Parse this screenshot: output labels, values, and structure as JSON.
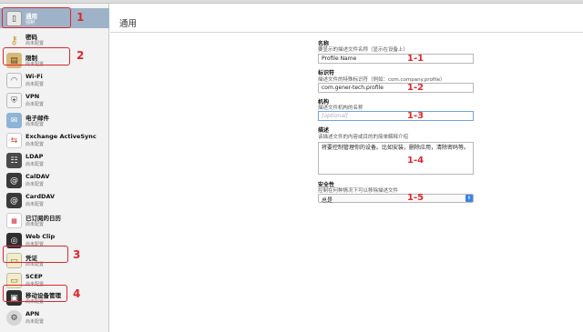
{
  "page": {
    "title": "通用"
  },
  "sidebar": {
    "items": [
      {
        "name": "通用",
        "sub": "强制",
        "icon": "general-profile-icon",
        "selected": true
      },
      {
        "name": "密码",
        "sub": "尚未配置",
        "icon": "key-icon"
      },
      {
        "name": "限制",
        "sub": "尚未配置",
        "icon": "restrictions-icon"
      },
      {
        "name": "Wi-Fi",
        "sub": "尚未配置",
        "icon": "wifi-icon"
      },
      {
        "name": "VPN",
        "sub": "尚未配置",
        "icon": "vpn-icon"
      },
      {
        "name": "电子邮件",
        "sub": "尚未配置",
        "icon": "email-icon"
      },
      {
        "name": "Exchange ActiveSync",
        "sub": "尚未配置",
        "icon": "exchange-icon"
      },
      {
        "name": "LDAP",
        "sub": "尚未配置",
        "icon": "ldap-icon"
      },
      {
        "name": "CalDAV",
        "sub": "尚未配置",
        "icon": "caldav-icon"
      },
      {
        "name": "CardDAV",
        "sub": "尚未配置",
        "icon": "carddav-icon"
      },
      {
        "name": "已订阅的日历",
        "sub": "尚未配置",
        "icon": "subscribed-calendar-icon"
      },
      {
        "name": "Web Clip",
        "sub": "尚未配置",
        "icon": "webclip-icon"
      },
      {
        "name": "凭证",
        "sub": "尚未配置",
        "icon": "certificate-icon"
      },
      {
        "name": "SCEP",
        "sub": "尚未配置",
        "icon": "scep-icon"
      },
      {
        "name": "移动设备管理",
        "sub": "尚未配置",
        "icon": "mdm-icon"
      },
      {
        "name": "APN",
        "sub": "尚未配置",
        "icon": "apn-icon"
      }
    ]
  },
  "annotations": {
    "sidebar": [
      "1",
      "2",
      "3",
      "4"
    ],
    "form": [
      "1-1",
      "1-2",
      "1-3",
      "1-4",
      "1-5"
    ]
  },
  "form": {
    "name": {
      "label": "名称",
      "desc": "要显示的描述文件名称（显示在设备上）",
      "value": "Profile Name"
    },
    "identifier": {
      "label": "标识符",
      "desc": "描述文件的特殊标识符（例如：com.company.profile）",
      "value": "com.gener-tech.profile"
    },
    "organization": {
      "label": "机构",
      "desc": "描述文件机构的名称",
      "placeholder": "[optional]"
    },
    "description": {
      "label": "描述",
      "desc": "该描述文件的内容或目的的简单解释介绍",
      "value": "将要控制管理你的设备。比如安装，删除应用，清除密码等。"
    },
    "security": {
      "label": "安全性",
      "desc": "控制在何种情况下可以移除描述文件",
      "value": "总是"
    }
  },
  "colors": {
    "highlight": "#e0262e",
    "selection": "#9fb3c8",
    "focus": "#6ea4e6"
  }
}
